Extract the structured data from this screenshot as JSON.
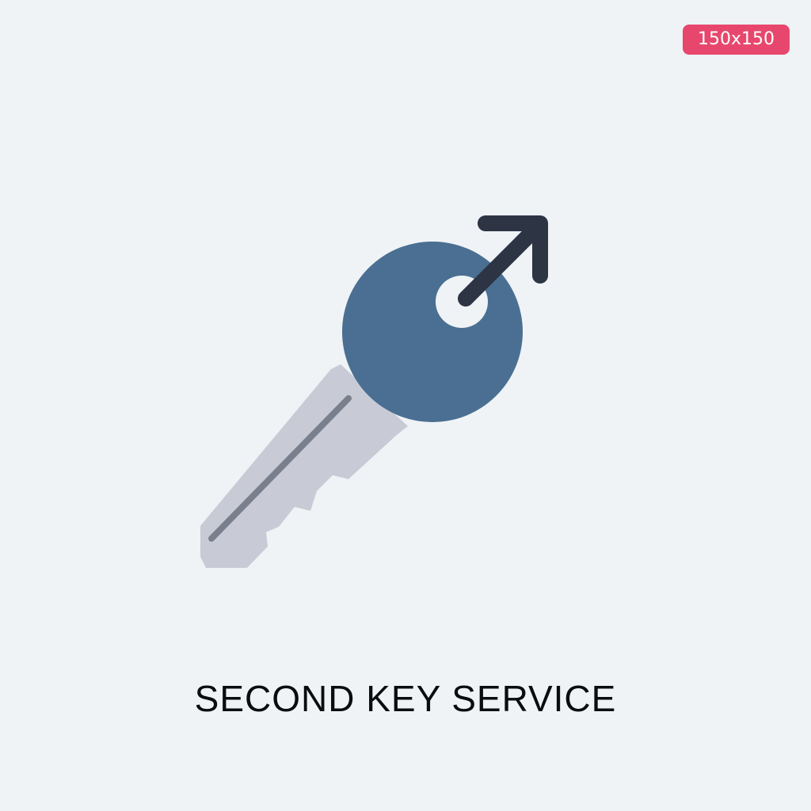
{
  "badge": {
    "label": "150x150",
    "color": "#e8476d"
  },
  "icon": {
    "name": "key-arrow-icon",
    "colors": {
      "head": "#4a6f92",
      "blade": "#c8cbd6",
      "blade_groove": "#7a7f8d",
      "arrow": "#2d3444",
      "background": "#eff3f6"
    }
  },
  "caption": {
    "text": "SECOND KEY SERVICE"
  }
}
